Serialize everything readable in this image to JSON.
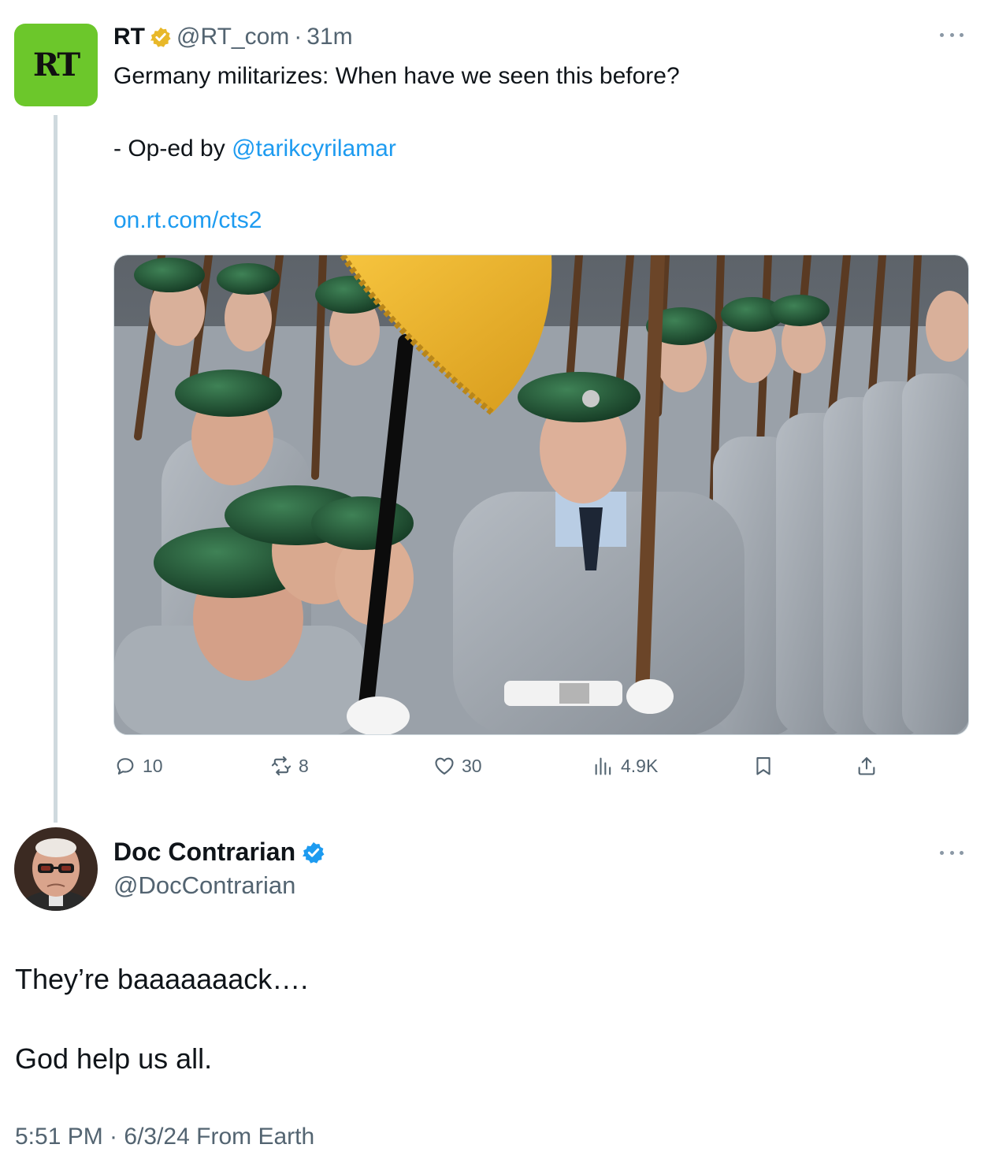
{
  "parent": {
    "avatar_text": "RT",
    "name": "RT",
    "handle": "@RT_com",
    "time": "31m",
    "line1": "Germany militarizes: When have we seen this before?",
    "oped_prefix": "- Op-ed by ",
    "oped_handle": "@tarikcyrilamar",
    "url": "on.rt.com/cts2",
    "stats": {
      "replies": "10",
      "reposts": "8",
      "likes": "30",
      "views": "4.9K"
    }
  },
  "reply": {
    "name": "Doc Contrarian",
    "handle": "@DocContrarian",
    "text1": "They’re baaaaaaack….",
    "text2": "God help us all.",
    "meta": "5:51 PM · 6/3/24 From Earth"
  },
  "colors": {
    "link": "#1d9bf0",
    "rt_green": "#6cc72b",
    "gold_badge": "#e8b829",
    "blue_badge": "#1d9bf0",
    "secondary_text": "#536471"
  }
}
